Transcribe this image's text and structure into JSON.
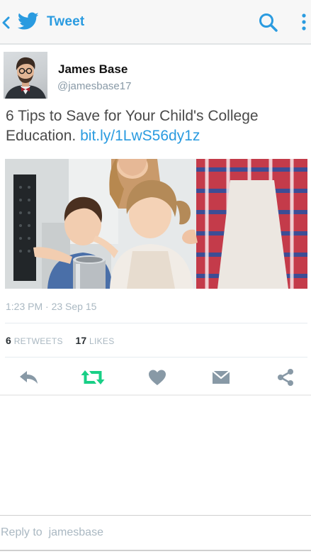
{
  "topbar": {
    "title": "Tweet",
    "back_icon": "chevron-left-icon",
    "logo_icon": "twitter-bird-icon",
    "search_icon": "search-icon",
    "more_icon": "more-vertical-icon"
  },
  "author": {
    "name": "James Base",
    "handle": "@jamesbase17"
  },
  "tweet": {
    "text": "6 Tips to Save for Your Child's College Education.",
    "link": "bit.ly/1LwS56dy1z",
    "timestamp": "1:23 PM · 23 Sep 15"
  },
  "stats": {
    "retweets_count": "6",
    "retweets_label": "RETWEETS",
    "likes_count": "17",
    "likes_label": "LIKES"
  },
  "actions": [
    {
      "icon": "reply-icon",
      "color": "#8899a6"
    },
    {
      "icon": "retweet-icon",
      "color": "#19cf86"
    },
    {
      "icon": "heart-icon",
      "color": "#8899a6"
    },
    {
      "icon": "direct-message-icon",
      "color": "#8899a6"
    },
    {
      "icon": "share-icon",
      "color": "#8899a6"
    }
  ],
  "reply": {
    "placeholder": "Reply to  jamesbase"
  },
  "colors": {
    "accent": "#2a9be0",
    "retweet_green": "#19cf86",
    "muted": "#aab8c2"
  }
}
